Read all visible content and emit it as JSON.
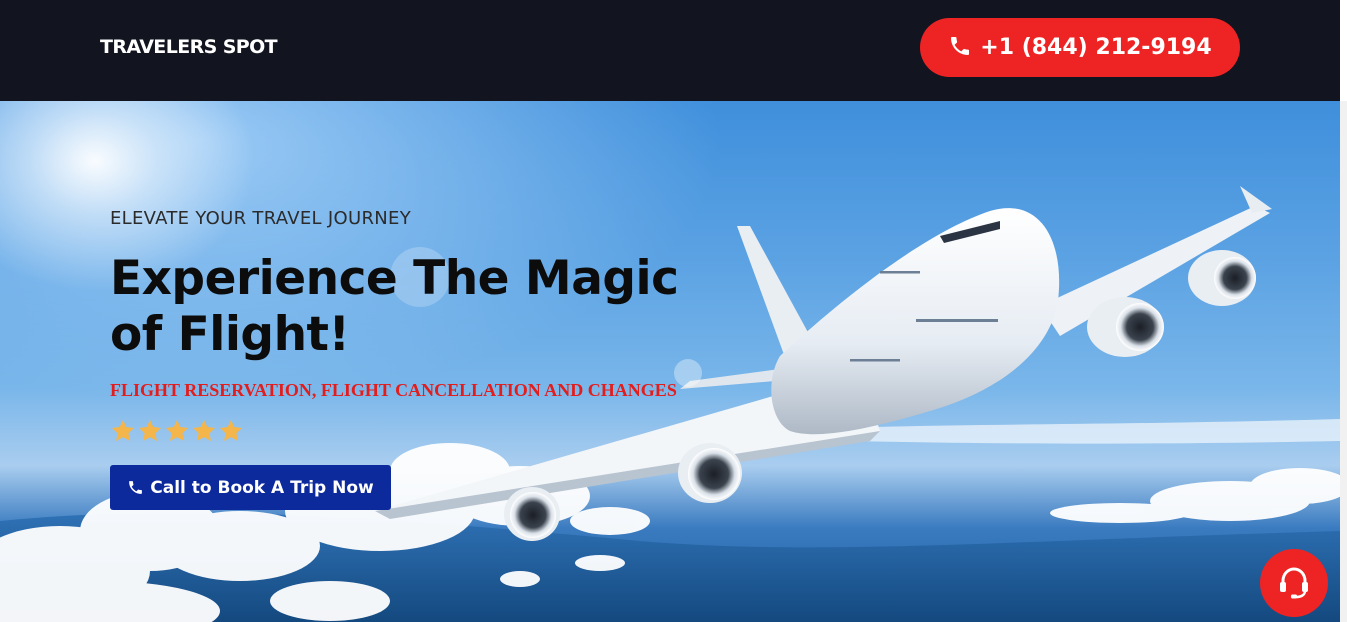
{
  "header": {
    "brand": "TRAVELERS SPOT",
    "phone_label": "+1 (844) 212-9194",
    "phone_icon": "phone-icon"
  },
  "hero": {
    "eyebrow": "ELEVATE YOUR TRAVEL JOURNEY",
    "headline_line1": "Experience The Magic",
    "headline_line2": "of Flight!",
    "subhead": "FLIGHT RESERVATION, FLIGHT CANCELLATION AND CHANGES",
    "rating": 5,
    "rating_max": 5,
    "cta_label": "Call to Book A Trip Now",
    "cta_icon": "phone-icon",
    "image": "airplane-over-clouds"
  },
  "support": {
    "icon": "headset-icon"
  },
  "colors": {
    "header_bg": "#12141f",
    "accent_red": "#ee2424",
    "cta_blue": "#0d2a9c",
    "star_gold": "#f4b54a",
    "subhead_red": "#e31c1c"
  }
}
